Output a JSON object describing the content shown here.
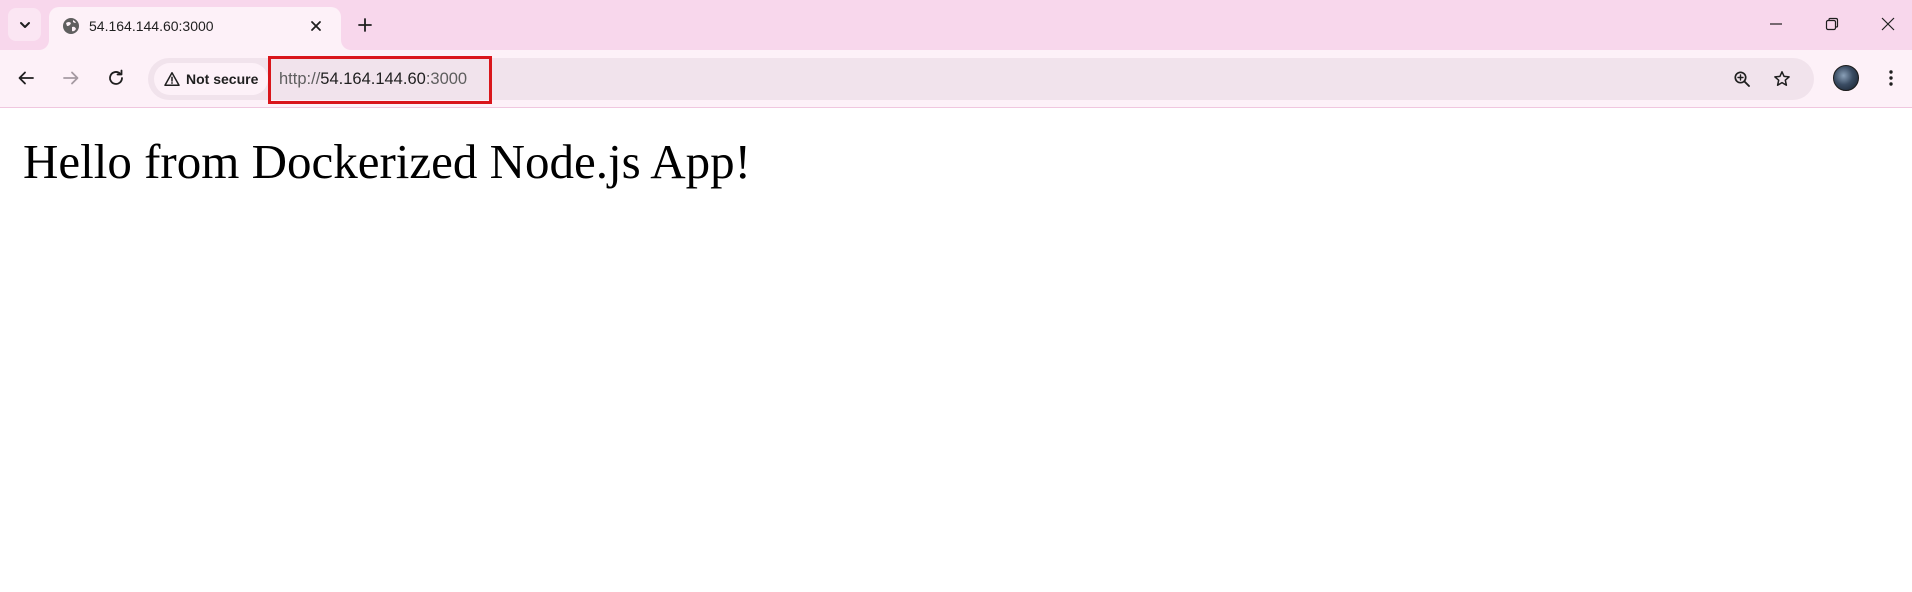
{
  "tab": {
    "title": "54.164.144.60:3000"
  },
  "toolbar": {
    "security_chip": "Not secure",
    "url_scheme": "http://",
    "url_host": "54.164.144.60",
    "url_port": ":3000",
    "highlight_color": "#d9151b"
  },
  "page": {
    "heading": "Hello from Dockerized Node.js App!"
  },
  "icons": {
    "tab_search": "chevron-down-icon",
    "favicon": "globe-icon",
    "tab_close": "close-icon",
    "new_tab": "plus-icon",
    "minimize": "minimize-icon",
    "restore": "restore-icon",
    "close_window": "close-window-icon",
    "back": "back-arrow-icon",
    "forward": "forward-arrow-icon",
    "reload": "reload-icon",
    "warning": "warning-icon",
    "zoom": "zoom-icon",
    "bookmark": "star-icon",
    "menu": "kebab-menu-icon"
  },
  "colors": {
    "tabstrip_bg": "#f8d7ec",
    "toolbar_bg": "#fdf1f8",
    "omnibox_bg": "#f1e3ec"
  }
}
